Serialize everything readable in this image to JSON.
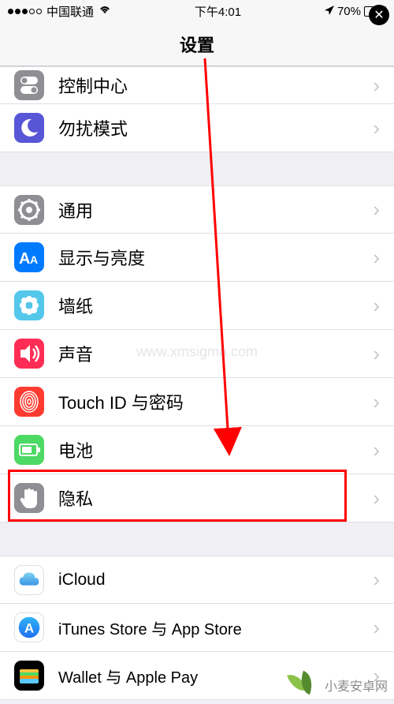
{
  "status": {
    "carrier": "中国联通",
    "time": "下午4:01",
    "battery_pct": "70%"
  },
  "header": {
    "title": "设置"
  },
  "groups": [
    {
      "rows": [
        {
          "key": "control-center",
          "label": "控制中心",
          "icon": "control-center-icon",
          "bg": "#8e8e93"
        },
        {
          "key": "dnd",
          "label": "勿扰模式",
          "icon": "moon-icon",
          "bg": "#5856d6"
        }
      ]
    },
    {
      "rows": [
        {
          "key": "general",
          "label": "通用",
          "icon": "gear-icon",
          "bg": "#8e8e93"
        },
        {
          "key": "display",
          "label": "显示与亮度",
          "icon": "text-size-icon",
          "bg": "#007aff"
        },
        {
          "key": "wallpaper",
          "label": "墙纸",
          "icon": "flower-icon",
          "bg": "#54c7eb"
        },
        {
          "key": "sounds",
          "label": "声音",
          "icon": "speaker-icon",
          "bg": "#ff2d55"
        },
        {
          "key": "touchid",
          "label": "Touch ID 与密码",
          "icon": "fingerprint-icon",
          "bg": "#ff3b30"
        },
        {
          "key": "battery",
          "label": "电池",
          "icon": "battery-icon",
          "bg": "#4cd964"
        },
        {
          "key": "privacy",
          "label": "隐私",
          "icon": "hand-icon",
          "bg": "#8e8e93"
        }
      ]
    },
    {
      "rows": [
        {
          "key": "icloud",
          "label": "iCloud",
          "sublabel": "",
          "icon": "cloud-icon",
          "bg": "#ffffff"
        },
        {
          "key": "itunes",
          "label": "iTunes Store 与 App Store",
          "icon": "appstore-icon",
          "bg": "#ffffff"
        },
        {
          "key": "wallet",
          "label": "Wallet 与 Apple Pay",
          "icon": "wallet-icon",
          "bg": "#000000"
        }
      ]
    }
  ],
  "watermark": {
    "text": "小麦安卓网",
    "url": "www.xmsigma.com"
  }
}
